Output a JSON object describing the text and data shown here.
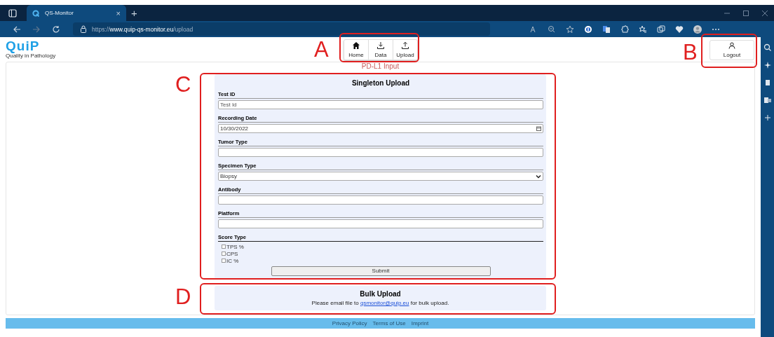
{
  "browser": {
    "tab_title": "QS-Monitor",
    "tab_close": "×",
    "new_tab": "+",
    "url": {
      "scheme": "https://",
      "host": "www.quip-qs-monitor.eu",
      "path": "/upload"
    }
  },
  "logo": {
    "text": "QuiP",
    "tagline": "Quality in Pathology"
  },
  "nav": [
    {
      "label": "Home"
    },
    {
      "label": "Data"
    },
    {
      "label": "Upload"
    }
  ],
  "logout": {
    "label": "Logout"
  },
  "page_title": "PD-L1 Input",
  "singleton": {
    "title": "Singleton Upload",
    "fields": [
      {
        "label": "Test ID",
        "kind": "text",
        "placeholder": "Test Id"
      },
      {
        "label": "Recording Date",
        "kind": "date",
        "value": "10/30/2022"
      },
      {
        "label": "Tumor Type",
        "kind": "text"
      },
      {
        "label": "Specimen Type",
        "kind": "select",
        "value": "Biopsy"
      },
      {
        "label": "Antibody",
        "kind": "text"
      },
      {
        "label": "Platform",
        "kind": "text"
      }
    ],
    "score_type": {
      "label": "Score Type",
      "options": [
        {
          "label": "TPS %",
          "checked": false
        },
        {
          "label": "CPS",
          "checked": false
        },
        {
          "label": "IC %",
          "checked": false
        }
      ]
    },
    "submit": "Submit"
  },
  "bulk": {
    "title": "Bulk Upload",
    "text_before": "Please email file to ",
    "email": "qsmonitor@quip.eu",
    "text_after": " for bulk upload."
  },
  "footer": [
    "Privacy Policy",
    "Terms of Use",
    "Imprint"
  ],
  "annotations": [
    {
      "letter": "A"
    },
    {
      "letter": "B"
    },
    {
      "letter": "C"
    },
    {
      "letter": "D"
    }
  ]
}
